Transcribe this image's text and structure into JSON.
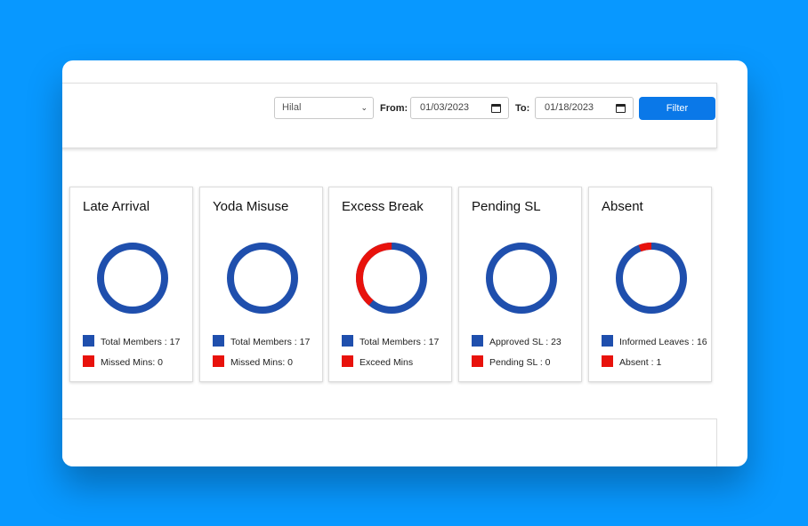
{
  "colors": {
    "primary": "#1f4fad",
    "danger": "#e8120c",
    "accent": "#0a78e8"
  },
  "filter": {
    "user_select": "Hilal",
    "from_label": "From:",
    "from_date": "01/03/2023",
    "to_label": "To:",
    "to_date": "01/18/2023",
    "button_label": "Filter"
  },
  "cards": [
    {
      "title": "Late Arrival",
      "legend": [
        "Total Members : 17",
        "Missed Mins: 0"
      ],
      "red_fraction": 0
    },
    {
      "title": "Yoda Misuse",
      "legend": [
        "Total Members : 17",
        "Missed Mins: 0"
      ],
      "red_fraction": 0
    },
    {
      "title": "Excess Break",
      "legend": [
        "Total Members : 17",
        "Exceed Mins"
      ],
      "red_fraction": 0.39
    },
    {
      "title": "Pending SL",
      "legend": [
        "Approved SL : 23",
        "Pending SL : 0"
      ],
      "red_fraction": 0
    },
    {
      "title": "Absent",
      "legend": [
        "Informed Leaves : 16",
        "Absent : 1"
      ],
      "red_fraction": 0.0588
    }
  ]
}
